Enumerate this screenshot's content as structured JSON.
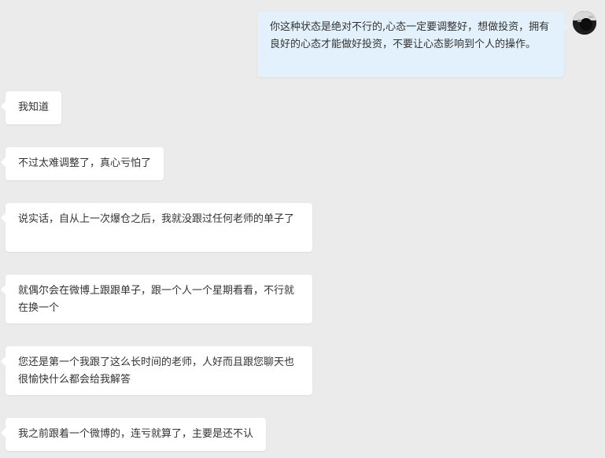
{
  "conversation": {
    "outgoing": [
      {
        "text": "你这种状态是绝对不行的,心态一定要调整好，想做投资，拥有良好的心态才能做好投资，不要让心态影响到个人的操作。"
      }
    ],
    "incoming": [
      {
        "text": "我知道"
      },
      {
        "text": "不过太难调整了，真心亏怕了"
      },
      {
        "text": "说实话，自从上一次爆仓之后，我就没跟过任何老师的单子了"
      },
      {
        "text": "就偶尔会在微博上跟跟单子，跟一个人一个星期看看，不行就在换一个"
      },
      {
        "text": "您还是第一个我跟了这么长时间的老师，人好而且跟您聊天也很愉快什么都会给我解答"
      },
      {
        "text": "我之前跟着一个微博的，连亏就算了，主要是还不认"
      }
    ]
  },
  "colors": {
    "background": "#ebebeb",
    "incoming_bubble": "#ffffff",
    "outgoing_bubble": "#e3f1fc",
    "text": "#333333"
  },
  "icons": {
    "avatar": "user-avatar-icon"
  }
}
